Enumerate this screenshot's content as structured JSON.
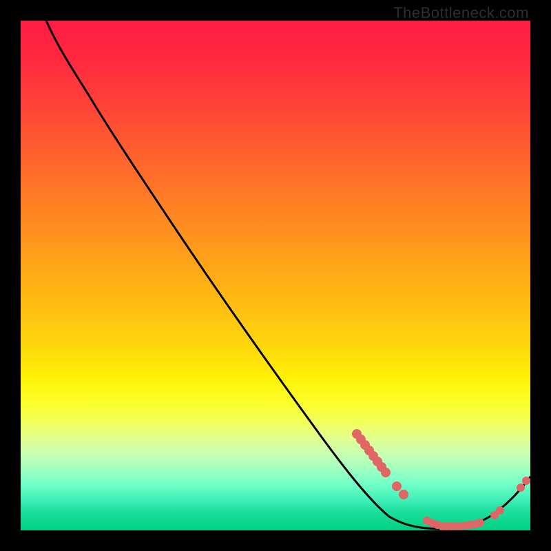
{
  "watermark": "TheBottleneck.com",
  "colors": {
    "background": "#000000",
    "curve": "#000000",
    "dots": "#e06666"
  },
  "chart_data": {
    "type": "line",
    "title": "",
    "xlabel": "",
    "ylabel": "",
    "xlim": [
      0,
      100
    ],
    "ylim": [
      0,
      100
    ],
    "grid": false,
    "note": "Axes are unlabeled; x and y values are estimated as percent of plot area (0–100). Curve descends from top-left, reaches minimum near x≈85, then rises slightly.",
    "series": [
      {
        "name": "curve",
        "x": [
          5,
          10,
          15,
          20,
          25,
          30,
          35,
          40,
          45,
          50,
          55,
          60,
          65,
          70,
          75,
          80,
          85,
          90,
          95,
          100
        ],
        "y": [
          100,
          96,
          91,
          85,
          79,
          72,
          65,
          58,
          51,
          44,
          37,
          30,
          23,
          17,
          11,
          6,
          2,
          2,
          5,
          10
        ]
      }
    ],
    "dot_clusters": [
      {
        "name": "left-dense-cluster",
        "x_range": [
          66,
          71
        ],
        "y_range": [
          17,
          22
        ],
        "count": 10
      },
      {
        "name": "mid-pair",
        "points": [
          [
            72,
            14
          ],
          [
            73.5,
            12
          ]
        ]
      },
      {
        "name": "bottom-flat-cluster",
        "x_range": [
          78,
          90
        ],
        "y_range": [
          1,
          4
        ],
        "count": 14
      },
      {
        "name": "rising-cluster",
        "points": [
          [
            92,
            3
          ],
          [
            93.5,
            4
          ],
          [
            98,
            8
          ],
          [
            99,
            10
          ]
        ]
      }
    ]
  }
}
